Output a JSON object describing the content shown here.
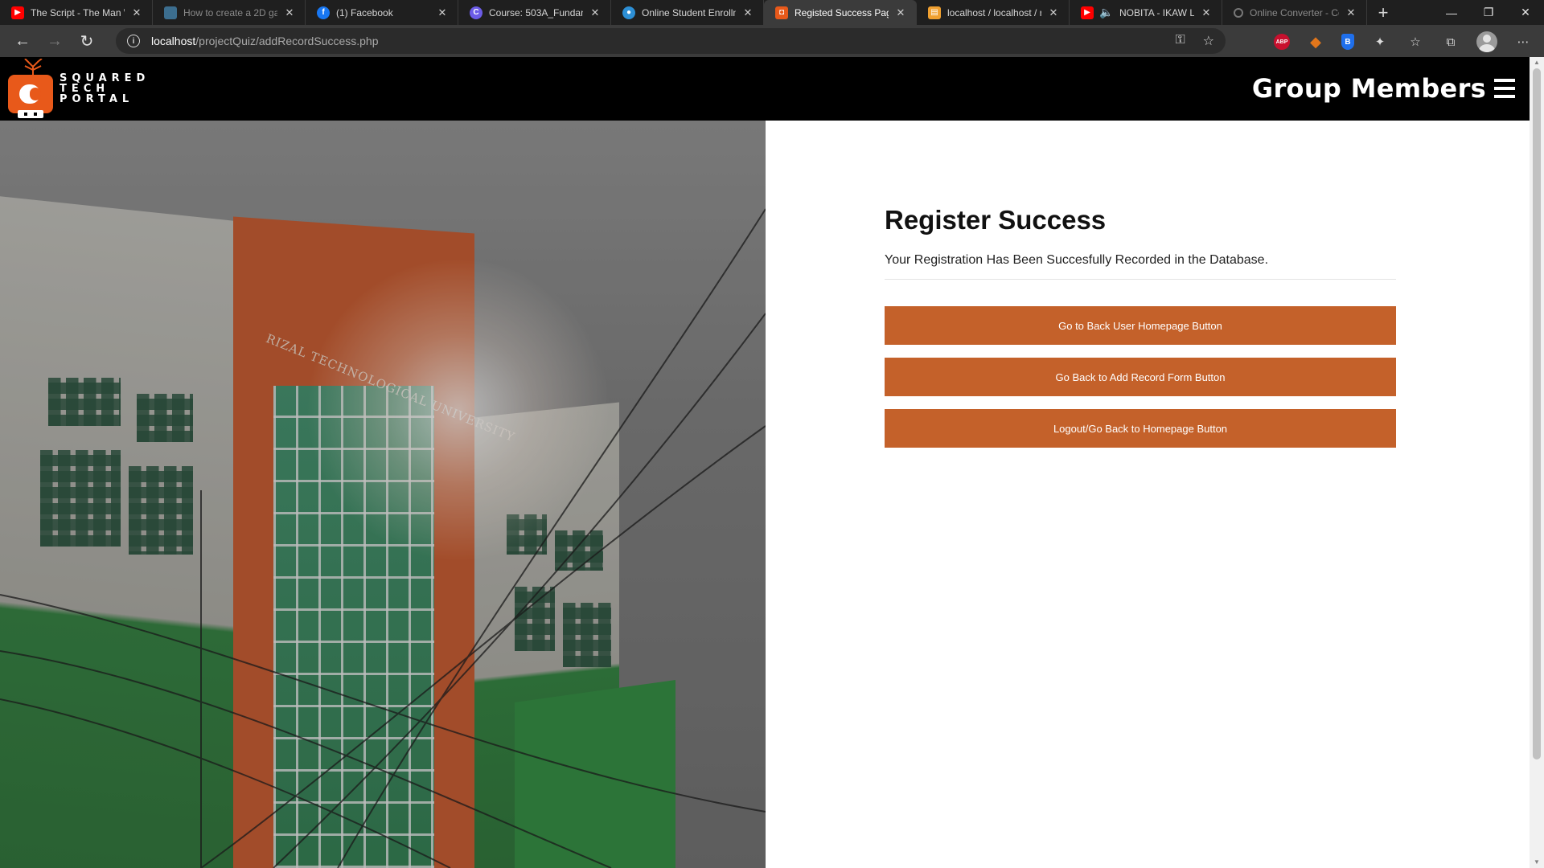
{
  "browser": {
    "tabs": [
      {
        "title": "The Script - The Man W",
        "favicon": "youtube-icon",
        "color": "#ff0000",
        "active": false
      },
      {
        "title": "How to create a 2D gar",
        "favicon": "page-icon",
        "color": "#3c6e8f",
        "active": false
      },
      {
        "title": "(1) Facebook",
        "favicon": "facebook-icon",
        "color": "#1877f2",
        "active": false
      },
      {
        "title": "Course: 503A_Fundame",
        "favicon": "course-icon",
        "color": "#6c5ce7",
        "active": false
      },
      {
        "title": "Online Student Enrollm",
        "favicon": "enroll-icon",
        "color": "#2d8fd5",
        "active": false
      },
      {
        "title": "Registed Success Page",
        "favicon": "html-icon",
        "color": "#e8591a",
        "active": true
      },
      {
        "title": "localhost / localhost / r",
        "favicon": "phpmyadmin-icon",
        "color": "#f0a030",
        "active": false
      },
      {
        "title": "NOBITA - IKAW LA",
        "favicon": "youtube-icon",
        "color": "#ff0000",
        "active": false
      },
      {
        "title": "Online Converter - Co",
        "favicon": "loading-icon",
        "color": "#888888",
        "active": false
      }
    ],
    "address": {
      "host": "localhost",
      "path": "/projectQuiz/addRecordSuccess.php"
    },
    "extensions": {
      "abp_label": "ABP"
    }
  },
  "site": {
    "logo_lines": [
      "SQUARED",
      "TECH",
      "PORTAL"
    ],
    "nav_title": "Group Members",
    "hero_sign": "RIZAL TECHNOLOGICAL UNIVERSITY"
  },
  "main": {
    "heading": "Register Success",
    "message": "Your Registration Has Been Succesfully Recorded in the Database.",
    "buttons": [
      "Go to Back User Homepage Button",
      "Go Back to Add Record Form Button",
      "Logout/Go Back to Homepage Button"
    ]
  },
  "colors": {
    "accent": "#c4612a",
    "header": "#000000",
    "logo": "#e8591a"
  }
}
